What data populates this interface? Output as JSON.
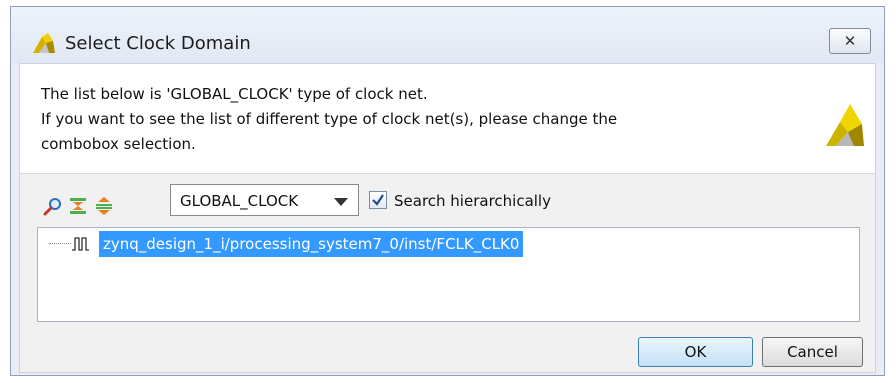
{
  "dialog": {
    "title": "Select Clock Domain",
    "close_glyph": "✕"
  },
  "message": {
    "line1": "The list below is 'GLOBAL_CLOCK' type of clock net.",
    "line2": "If you want to see the list of different type of clock net(s), please change the",
    "line3": "combobox selection."
  },
  "toolbar": {
    "icons": [
      "search-icon",
      "collapse-all-icon",
      "expand-all-icon"
    ],
    "clock_type": {
      "selected": "GLOBAL_CLOCK"
    },
    "search_hierarchically": {
      "label": "Search hierarchically",
      "checked": true
    }
  },
  "tree": {
    "items": [
      {
        "label": "zynq_design_1_i/processing_system7_0/inst/FCLK_CLK0",
        "icon": "clock-pulse-icon",
        "selected": true
      }
    ]
  },
  "buttons": {
    "ok": "OK",
    "cancel": "Cancel"
  },
  "colors": {
    "selection": "#3399ff",
    "brand": "#c9b200"
  }
}
